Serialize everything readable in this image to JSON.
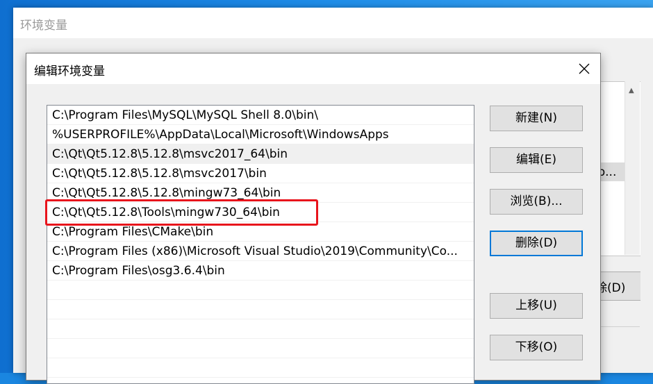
{
  "background_window": {
    "title": "环境变量",
    "selected_value_fragment": "\\Ap...",
    "delete_button_fragment": "删除(D)"
  },
  "dialog": {
    "title": "编辑环境变量",
    "close_icon": "close-icon"
  },
  "path_list": {
    "items": [
      "C:\\Program Files\\MySQL\\MySQL Shell 8.0\\bin\\",
      "%USERPROFILE%\\AppData\\Local\\Microsoft\\WindowsApps",
      "C:\\Qt\\Qt5.12.8\\5.12.8\\msvc2017_64\\bin",
      "C:\\Qt\\Qt5.12.8\\5.12.8\\msvc2017\\bin",
      "C:\\Qt\\Qt5.12.8\\5.12.8\\mingw73_64\\bin",
      "C:\\Qt\\Qt5.12.8\\Tools\\mingw730_64\\bin",
      "C:\\Program Files\\CMake\\bin",
      "C:\\Program Files (x86)\\Microsoft Visual Studio\\2019\\Community\\Co...",
      "C:\\Program Files\\osg3.6.4\\bin",
      "",
      "",
      "",
      "",
      ""
    ],
    "highlighted_item": "C:\\Qt\\Qt5.12.8\\Tools\\mingw730_64\\bin",
    "highlight_color": "#e8141c"
  },
  "buttons": {
    "new": "新建(N)",
    "edit": "编辑(E)",
    "browse": "浏览(B)...",
    "delete": "删除(D)",
    "move_up": "上移(U)",
    "move_down": "下移(O)"
  },
  "colors": {
    "accent": "#0078d7",
    "desktop": "#1a86e0"
  }
}
